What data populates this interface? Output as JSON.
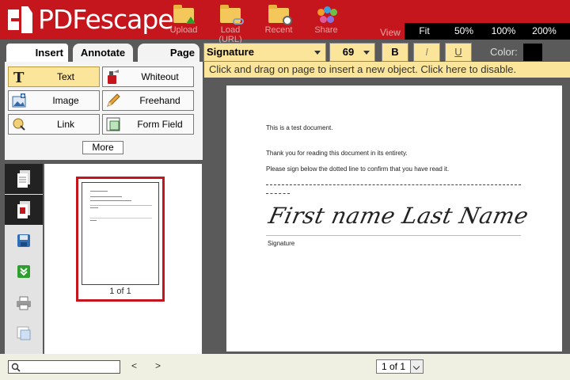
{
  "app": {
    "logo_text": "PDFescape",
    "header_buttons": [
      {
        "label": "Upload"
      },
      {
        "label": "Load (URL)"
      },
      {
        "label": "Recent"
      },
      {
        "label": "Share"
      }
    ],
    "view_label": "View",
    "view_options": [
      "Fit",
      "50%",
      "100%",
      "200%"
    ]
  },
  "tabs": [
    {
      "label": "Insert",
      "active": true
    },
    {
      "label": "Annotate",
      "active": false
    },
    {
      "label": "Page",
      "active": false
    }
  ],
  "tools": [
    {
      "label": "Text",
      "icon": "text-tool-icon",
      "active": true
    },
    {
      "label": "Whiteout",
      "icon": "whiteout-icon",
      "active": false
    },
    {
      "label": "Image",
      "icon": "image-icon",
      "active": false
    },
    {
      "label": "Freehand",
      "icon": "pencil-icon",
      "active": false
    },
    {
      "label": "Link",
      "icon": "link-icon",
      "active": false
    },
    {
      "label": "Form Field",
      "icon": "form-field-icon",
      "active": false
    }
  ],
  "more_label": "More",
  "format": {
    "font": "Signature",
    "size": "69",
    "bold": "B",
    "italic": "I",
    "underline": "U",
    "color_label": "Color:",
    "color_value": "#000000"
  },
  "infobar": "Click and drag on page to insert a new object. Click here to disable.",
  "document": {
    "line1": "This is a test document.",
    "line2": "Thank you for reading this document in its entirety.",
    "line3": "Please sign below the dotted line to confirm that you have read it.",
    "signature": "First name Last Name",
    "signature_label": "Signature"
  },
  "thumbnail": {
    "label": "1 of 1"
  },
  "bottom": {
    "search_placeholder": "",
    "prev": "<",
    "next": ">",
    "page_value": "1 of 1"
  }
}
